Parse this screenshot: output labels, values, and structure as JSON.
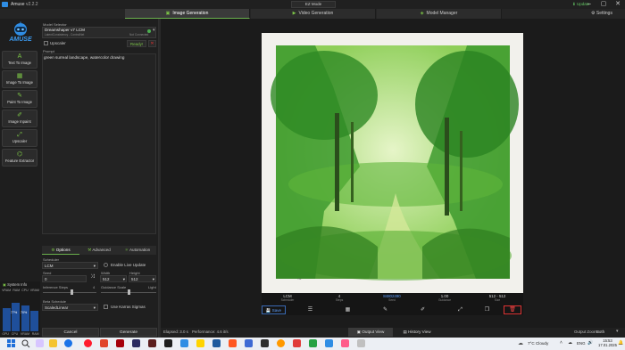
{
  "window": {
    "title": "Amuse",
    "version": "v2.2.2",
    "update_label": "Update",
    "ez_mode_label": "EZ Mode"
  },
  "tabs": [
    {
      "label": "Image Generation",
      "icon": "image-icon",
      "active": true
    },
    {
      "label": "Video Generation",
      "icon": "video-icon",
      "active": false
    },
    {
      "label": "Model Manager",
      "icon": "cube-icon",
      "active": false
    }
  ],
  "settings_label": "Settings",
  "logo_text": "AMUSE",
  "nav": [
    {
      "label": "Text To Image",
      "icon": "text-icon"
    },
    {
      "label": "Image To Image",
      "icon": "image-icon"
    },
    {
      "label": "Paint To Image",
      "icon": "brush-icon"
    },
    {
      "label": "Image Inpaint",
      "icon": "inpaint-icon"
    },
    {
      "label": "Upscaler",
      "icon": "expand-icon"
    },
    {
      "label": "Feature Extractor",
      "icon": "extract-icon"
    }
  ],
  "system_info": {
    "title": "System Info",
    "top_labels": [
      "VRAM",
      "RAM",
      "CPU",
      "VRAM"
    ],
    "bars": [
      {
        "label": "GPU",
        "value": 62
      },
      {
        "label": "CPU",
        "value": 77
      },
      {
        "label": "VRAM",
        "value": 70
      },
      {
        "label": "RAM",
        "value": 55
      }
    ],
    "bar_texts": [
      "77%",
      "70%"
    ]
  },
  "model": {
    "section_label": "Model Selector",
    "name": "Dreamshaper v7 LCM",
    "sub_left": "LatentConsistency - ControlNet",
    "sub_right": "Not Connected",
    "ready_label": "Ready!",
    "cancel_x": "✕",
    "upscaler_label": "Upscaler"
  },
  "prompt": {
    "label": "Prompt",
    "text": "green surreal landscape, watercolor drawing"
  },
  "option_tabs": [
    {
      "label": "Options",
      "active": true
    },
    {
      "label": "Advanced",
      "active": false
    },
    {
      "label": "Automation",
      "active": false
    }
  ],
  "options": {
    "scheduler_label": "Scheduler",
    "scheduler_value": "LCM",
    "live_update_label": "Enable Live Update",
    "seed_label": "Seed",
    "seed_value": "0",
    "width_label": "Width",
    "width_value": "512",
    "height_label": "Height",
    "height_value": "512",
    "steps_label": "Inference Steps",
    "steps_value": "4",
    "guidance_label": "Guidance Scale",
    "guidance_value": "Light",
    "beta_label": "Beta Schedule",
    "beta_value": "ScaledLinear",
    "karras_label": "Use Karras Sigmas"
  },
  "buttons": {
    "cancel": "Cancel",
    "generate": "Generate"
  },
  "result_info": [
    {
      "value": "LCM",
      "key": "Scheduler"
    },
    {
      "value": "4",
      "key": "Steps"
    },
    {
      "value": "84802490",
      "key": "Seed"
    },
    {
      "value": "1.00",
      "key": "Guidance"
    },
    {
      "value": "512 - 512",
      "key": "Size"
    }
  ],
  "toolbar": {
    "save_label": "Save"
  },
  "status": {
    "elapsed": "Elapsed: 3.0 s",
    "performance": "Performance: 4.6 it/s",
    "output_view": "Output View",
    "history_view": "History View",
    "output_zoom_label": "Output Zoom",
    "output_zoom_value": "Both"
  },
  "taskbar": {
    "weather": "7°C Cloudy",
    "lang": "ENG",
    "time": "15:53",
    "date": "17.01.2025"
  }
}
